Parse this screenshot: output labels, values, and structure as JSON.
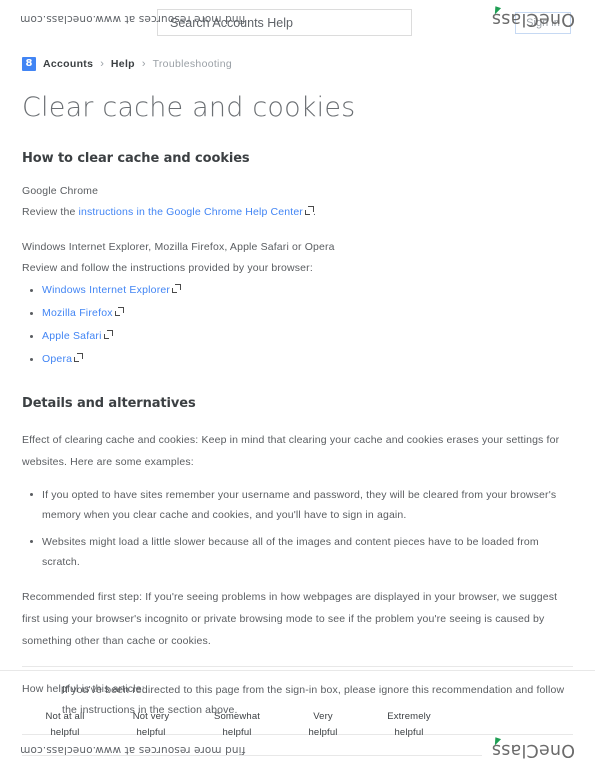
{
  "watermark": {
    "brand": "OneClass",
    "url": "find more resources at www.oneclass.com"
  },
  "header": {
    "search_placeholder": "Search Accounts Help",
    "search_value": "",
    "signin_label": "Sign in"
  },
  "breadcrumb": {
    "icon": "google-accounts-icon",
    "items": [
      {
        "label": "Accounts",
        "current": false
      },
      {
        "label": "Help",
        "current": false
      },
      {
        "label": "Troubleshooting",
        "current": true
      }
    ],
    "separator": "›"
  },
  "main": {
    "title": "Clear cache and cookies",
    "section1": {
      "heading": "How to clear cache and cookies",
      "chrome_label": "Google Chrome",
      "chrome_review_prefix": "Review the ",
      "chrome_link": "instructions in the Google Chrome Help Center",
      "chrome_review_suffix": ".",
      "other_browsers_label": "Windows Internet Explorer, Mozilla Firefox, Apple Safari or Opera",
      "other_browsers_intro": "Review and follow the instructions provided by your browser:",
      "browser_links": [
        "Windows Internet Explorer",
        "Mozilla Firefox",
        "Apple Safari",
        "Opera"
      ]
    },
    "section2": {
      "heading": "Details and alternatives",
      "effect_para": "Effect of clearing cache and cookies: Keep in mind that clearing your cache and cookies erases your settings for websites. Here are some examples:",
      "effect_bullets": [
        "If you opted to have sites remember your username and password, they will be cleared from your browser's memory when you clear cache and cookies, and you'll have to sign in again.",
        "Websites might load a little slower because all of the images and content pieces have to be loaded from scratch."
      ],
      "recommended_para": "Recommended first step: If you're seeing problems in how webpages are displayed in your browser, we suggest first using your browser's incognito or private browsing mode to see if the problem you're seeing is caused by something other than cache or cookies.",
      "callout": "If you've been redirected to this page from the sign-in box, please ignore this recommendation and follow the instructions in the section above."
    }
  },
  "rating": {
    "question": "How helpful is this article:",
    "options": [
      {
        "line1": "Not at all",
        "line2": "helpful"
      },
      {
        "line1": "Not very",
        "line2": "helpful"
      },
      {
        "line1": "Somewhat",
        "line2": "helpful"
      },
      {
        "line1": "Very",
        "line2": "helpful"
      },
      {
        "line1": "Extremely",
        "line2": "helpful"
      }
    ]
  },
  "colors": {
    "link": "#4285f4",
    "brand_blue": "#4285f4",
    "leaf_green": "#1e9e53",
    "text": "#5a5d61",
    "heading": "#3c4043",
    "muted": "#9aa0a6",
    "rule": "#e8e8e8"
  }
}
